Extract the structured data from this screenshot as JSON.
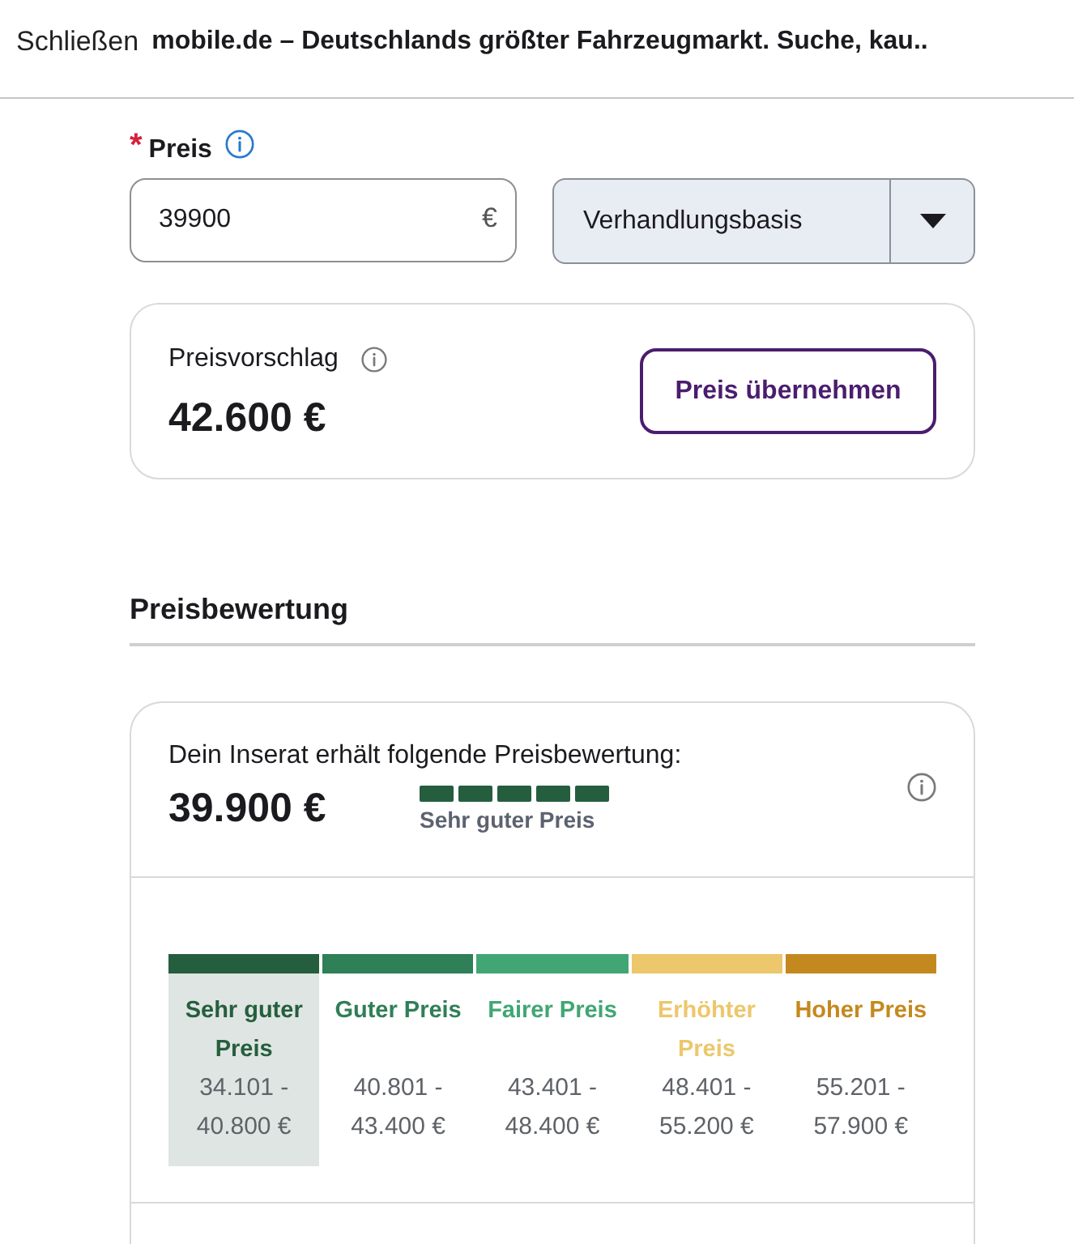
{
  "header": {
    "close_label": "Schließen",
    "title": "mobile.de – Deutschlands größter Fahrzeugmarkt. Suche, kau.."
  },
  "price": {
    "required_mark": "*",
    "label": "Preis",
    "value": "39900",
    "currency": "€",
    "price_type": "Verhandlungsbasis"
  },
  "suggestion": {
    "label": "Preisvorschlag",
    "value": "42.600 €",
    "button": "Preis übernehmen"
  },
  "rating_section": {
    "heading": "Preisbewertung",
    "intro": "Dein Inserat erhält folgende Preisbewertung:",
    "price": "39.900 €",
    "stars": 5,
    "rating_label": "Sehr guter Preis",
    "categories": [
      {
        "label": "Sehr guter Preis",
        "range": "34.101 - 40.800 €",
        "color": "#255e3e",
        "selected": true
      },
      {
        "label": "Guter Preis",
        "range": "40.801 - 43.400 €",
        "color": "#2f7f57",
        "selected": false
      },
      {
        "label": "Fairer Preis",
        "range": "43.401 - 48.400 €",
        "color": "#42a674",
        "selected": false
      },
      {
        "label": "Erhöhter Preis",
        "range": "48.401 - 55.200 €",
        "color": "#ecc76b",
        "selected": false
      },
      {
        "label": "Hoher Preis",
        "range": "55.201 - 57.900 €",
        "color": "#c4891e",
        "selected": false
      }
    ]
  }
}
